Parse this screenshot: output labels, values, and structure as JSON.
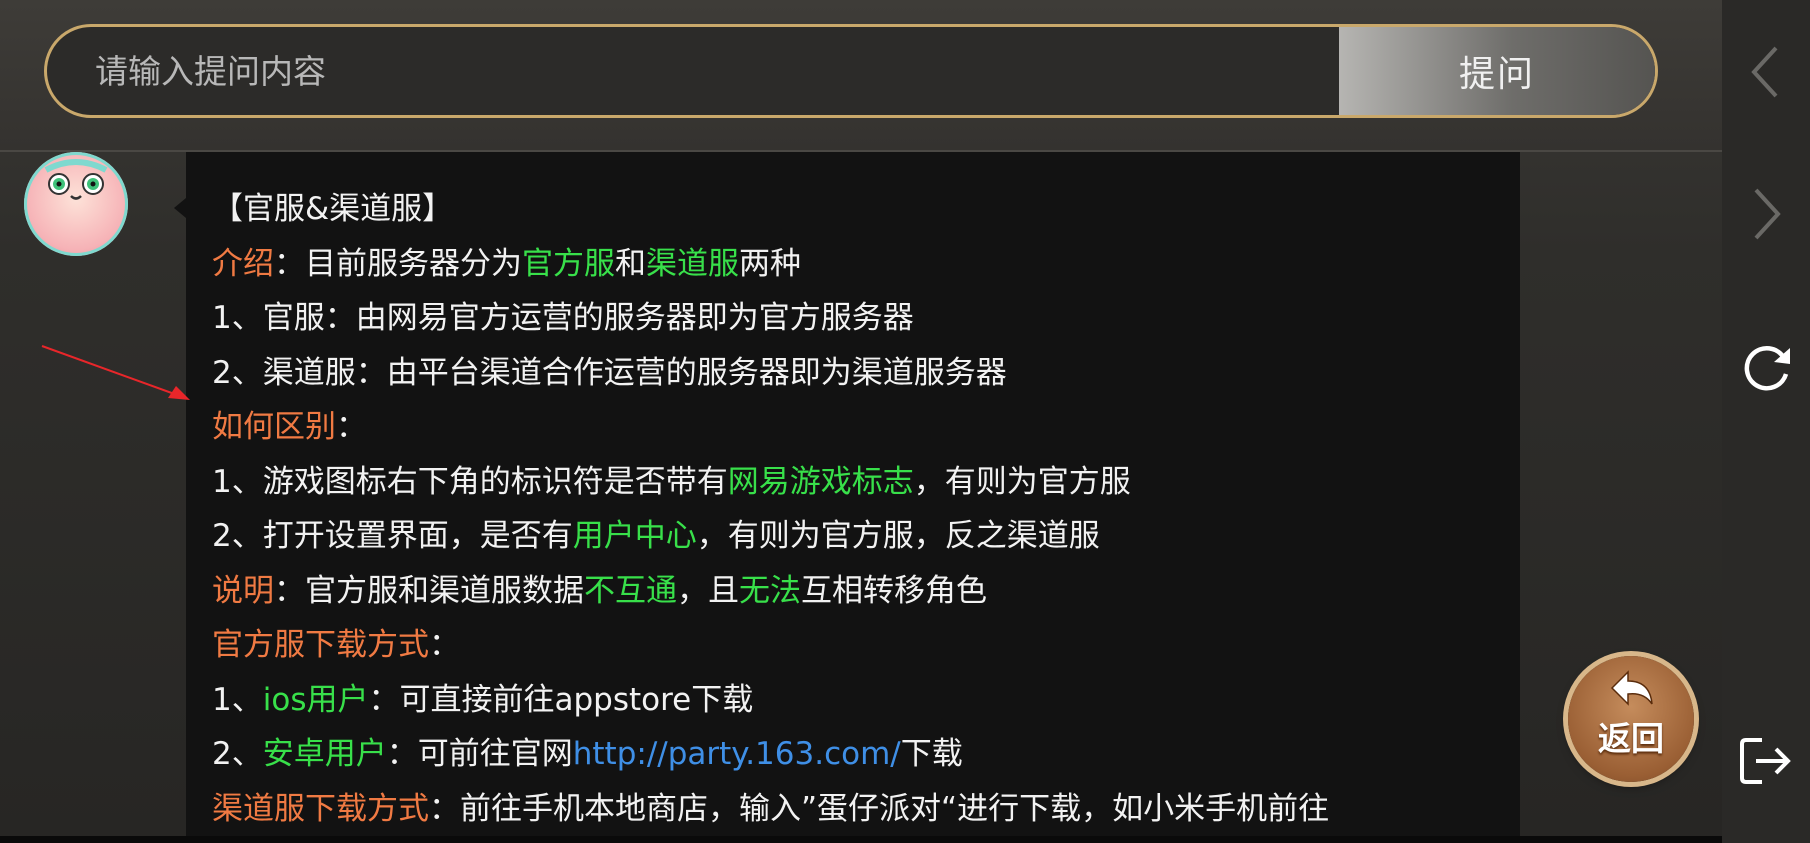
{
  "search": {
    "placeholder": "请输入提问内容",
    "value": "",
    "ask_label": "提问"
  },
  "message": {
    "lines": [
      [
        {
          "t": "【官服&渠道服】",
          "c": "w"
        }
      ],
      [
        {
          "t": "介绍",
          "c": "o"
        },
        {
          "t": "：目前服务器分为",
          "c": "w"
        },
        {
          "t": "官方服",
          "c": "g"
        },
        {
          "t": "和",
          "c": "w"
        },
        {
          "t": "渠道服",
          "c": "g"
        },
        {
          "t": "两种",
          "c": "w"
        }
      ],
      [
        {
          "t": "1、官服：由网易官方运营的服务器即为官方服务器",
          "c": "w"
        }
      ],
      [
        {
          "t": "2、渠道服：由平台渠道合作运营的服务器即为渠道服务器",
          "c": "w"
        }
      ],
      [
        {
          "t": "如何区别",
          "c": "o"
        },
        {
          "t": "：",
          "c": "w"
        }
      ],
      [
        {
          "t": "1、游戏图标右下角的标识符是否带有",
          "c": "w"
        },
        {
          "t": "网易游戏标志",
          "c": "g"
        },
        {
          "t": "，有则为官方服",
          "c": "w"
        }
      ],
      [
        {
          "t": "2、打开设置界面，是否有",
          "c": "w"
        },
        {
          "t": "用户中心",
          "c": "g"
        },
        {
          "t": "，有则为官方服，反之渠道服",
          "c": "w"
        }
      ],
      [
        {
          "t": "说明",
          "c": "o"
        },
        {
          "t": "：官方服和渠道服数据",
          "c": "w"
        },
        {
          "t": "不互通",
          "c": "g"
        },
        {
          "t": "，且",
          "c": "w"
        },
        {
          "t": "无法",
          "c": "g"
        },
        {
          "t": "互相转移角色",
          "c": "w"
        }
      ],
      [
        {
          "t": "官方服下载方式",
          "c": "o"
        },
        {
          "t": "：",
          "c": "w"
        }
      ],
      [
        {
          "t": "1、",
          "c": "w"
        },
        {
          "t": "ios用户",
          "c": "g"
        },
        {
          "t": "：可直接前往appstore下载",
          "c": "w"
        }
      ],
      [
        {
          "t": "2、",
          "c": "w"
        },
        {
          "t": "安卓用户",
          "c": "g"
        },
        {
          "t": "：可前往官网",
          "c": "w"
        },
        {
          "t": "http://party.163.com/",
          "c": "b"
        },
        {
          "t": "下载",
          "c": "w"
        }
      ],
      [
        {
          "t": "渠道服下载方式",
          "c": "o"
        },
        {
          "t": "：前往手机本地商店，输入”蛋仔派对“进行下载，如小米手机前往",
          "c": "w"
        }
      ]
    ]
  },
  "back_button": {
    "label": "返回"
  },
  "system_bar": {
    "icons": [
      "chevron-left-icon",
      "chevron-right-icon",
      "refresh-icon",
      "exit-icon"
    ]
  },
  "colors": {
    "accent_orange": "#f07a43",
    "highlight_green": "#38e04a",
    "link_blue": "#3f8fe6",
    "search_border": "#c9a86b"
  }
}
